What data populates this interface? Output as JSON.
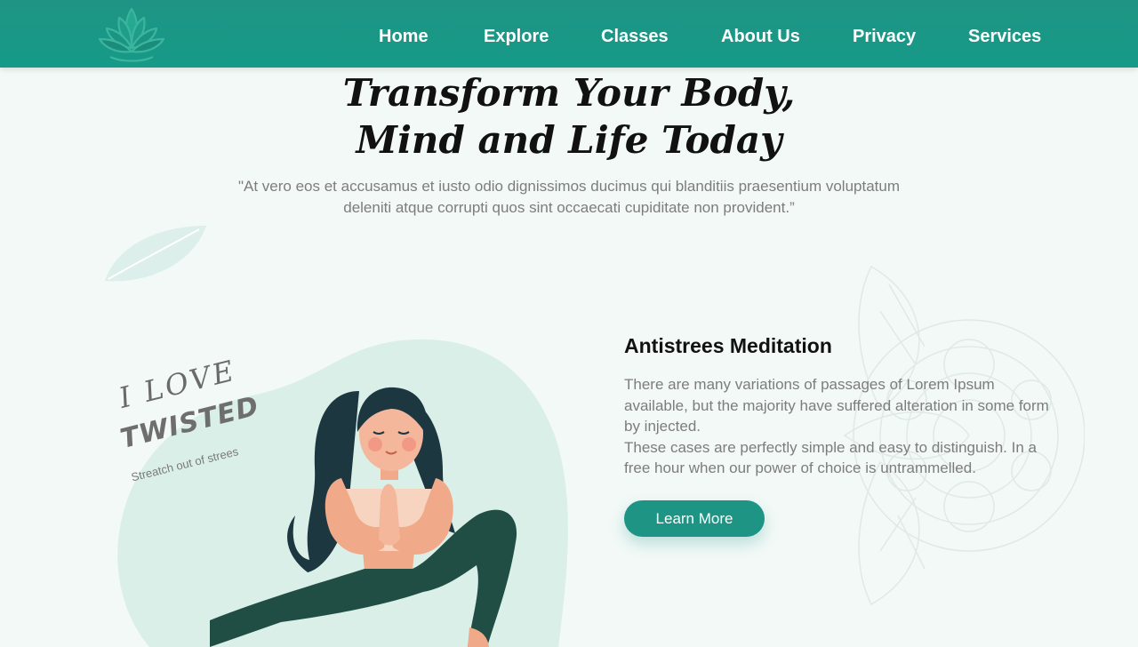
{
  "nav": {
    "items": [
      {
        "label": "Home"
      },
      {
        "label": "Explore"
      },
      {
        "label": "Classes"
      },
      {
        "label": "About Us"
      },
      {
        "label": "Privacy"
      },
      {
        "label": "Services"
      }
    ]
  },
  "hero": {
    "title_line1": "Transform Your Body,",
    "title_line2": "Mind and Life Today",
    "quote_line1": "\"At vero eos et accusamus et iusto odio dignissimos ducimus qui blanditiis praesentium voluptatum",
    "quote_line2": "deleniti atque corrupti quos sint occaecati cupiditate non provident.”"
  },
  "badge": {
    "line1": "I LOVE",
    "line2": "TWISTED",
    "line3": "Streatch out of strees"
  },
  "feature": {
    "title": "Antistrees Meditation",
    "paragraph1": "There are many variations of passages of Lorem Ipsum available, but the majority have suffered alteration in some form by injected.",
    "paragraph2": "These cases are perfectly simple and easy to distinguish. In a free hour when our power of choice is untrammelled.",
    "button_label": "Learn More"
  },
  "icons": {
    "logo": "lotus-logo-icon",
    "leaf": "leaf-icon",
    "mandala": "mandala-icon",
    "illustration": "yoga-woman-illustration"
  },
  "colors": {
    "primary": "#1e9584",
    "background": "#f2f9f7",
    "blob": "#d9efe8"
  }
}
